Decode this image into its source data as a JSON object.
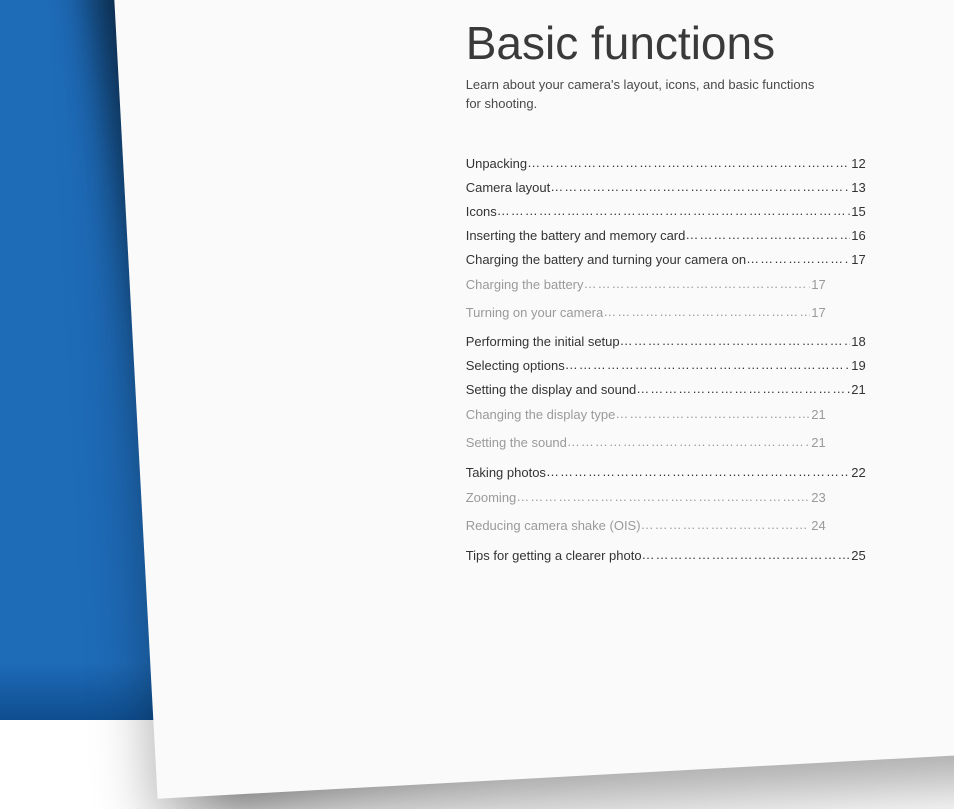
{
  "title": "Basic functions",
  "subtitle": "Learn about your camera's layout, icons, and basic functions for shooting.",
  "toc": [
    {
      "label": "Unpacking",
      "page": "12",
      "level": "main"
    },
    {
      "label": "Camera layout",
      "page": "13",
      "level": "main"
    },
    {
      "label": "Icons",
      "page": "15",
      "level": "main"
    },
    {
      "label": "Inserting the battery and memory card",
      "page": "16",
      "level": "main"
    },
    {
      "label": "Charging the battery and turning your camera on",
      "page": "17",
      "level": "main"
    },
    {
      "label": "Charging the battery",
      "page": "17",
      "level": "sub"
    },
    {
      "label": "Turning on your camera",
      "page": "17",
      "level": "sub"
    },
    {
      "label": "Performing the initial setup",
      "page": "18",
      "level": "main",
      "gapBefore": true
    },
    {
      "label": "Selecting options",
      "page": "19",
      "level": "main"
    },
    {
      "label": "Setting the display and sound",
      "page": "21",
      "level": "main"
    },
    {
      "label": "Changing the display type",
      "page": "21",
      "level": "sub"
    },
    {
      "label": "Setting the sound",
      "page": "21",
      "level": "sub"
    },
    {
      "label": "Taking photos",
      "page": "22",
      "level": "main",
      "gapBefore": true
    },
    {
      "label": "Zooming",
      "page": "23",
      "level": "sub"
    },
    {
      "label": "Reducing camera shake (OIS)",
      "page": "24",
      "level": "sub"
    },
    {
      "label": "Tips for getting a clearer photo",
      "page": "25",
      "level": "main",
      "gapBefore": true
    }
  ]
}
